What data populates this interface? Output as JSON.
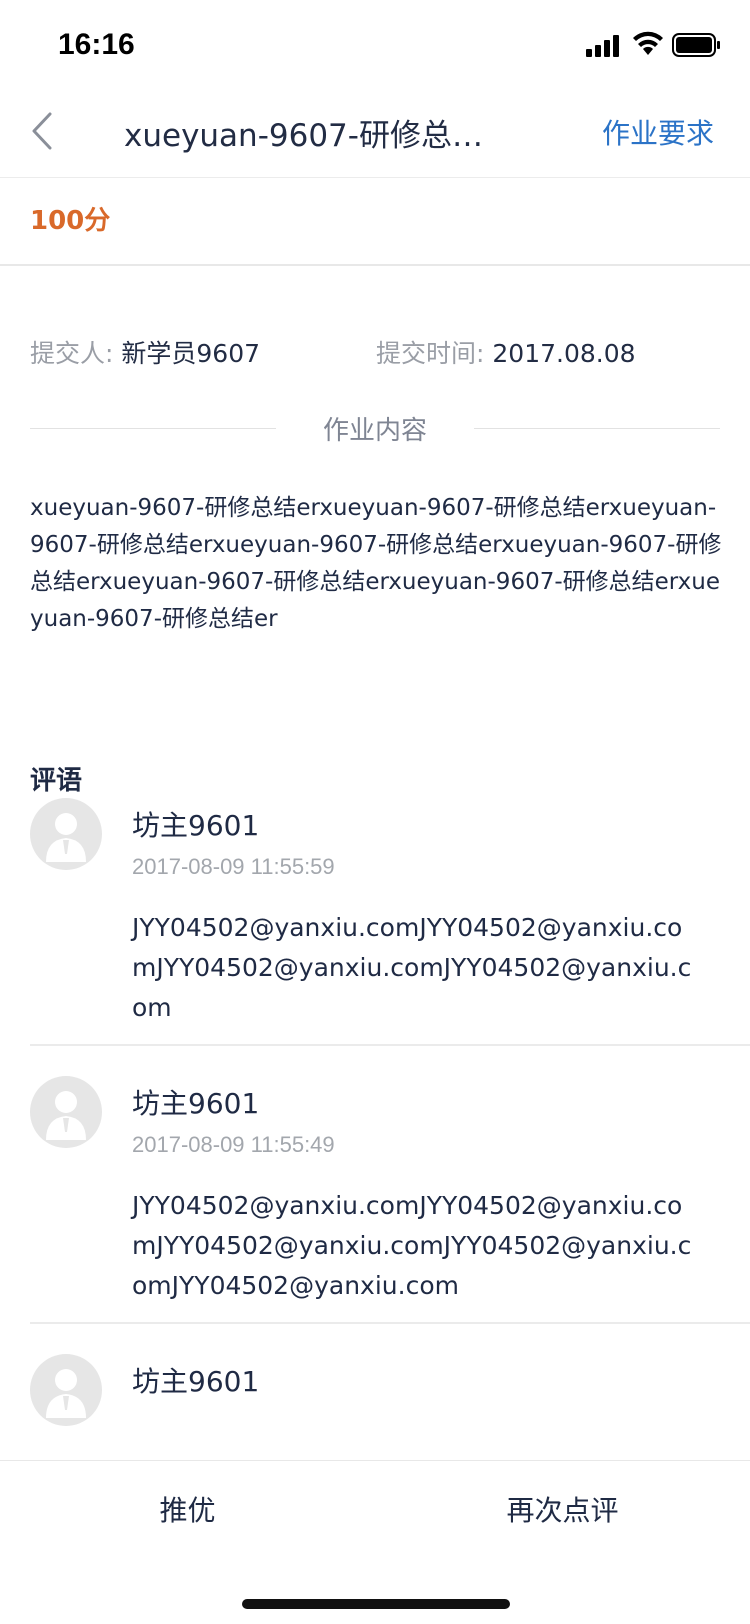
{
  "status_bar": {
    "time": "16:16"
  },
  "nav": {
    "title": "xueyuan-9607-研修总…",
    "action": "作业要求"
  },
  "score": "100分",
  "submit": {
    "submitter_label": "提交人:",
    "submitter_value": "新学员9607",
    "time_label": "提交时间:",
    "time_value": "2017.08.08"
  },
  "section_title": "作业内容",
  "content_text": "xueyuan-9607-研修总结erxueyuan-9607-研修总结erxueyuan-9607-研修总结erxueyuan-9607-研修总结erxueyuan-9607-研修总结erxueyuan-9607-研修总结erxueyuan-9607-研修总结erxueyuan-9607-研修总结er",
  "comments_title": "评语",
  "comments": [
    {
      "name": "坊主9601",
      "time": "2017-08-09 11:55:59",
      "text": "JYY04502@yanxiu.comJYY04502@yanxiu.comJYY04502@yanxiu.comJYY04502@yanxiu.com"
    },
    {
      "name": "坊主9601",
      "time": "2017-08-09 11:55:49",
      "text": "JYY04502@yanxiu.comJYY04502@yanxiu.comJYY04502@yanxiu.comJYY04502@yanxiu.comJYY04502@yanxiu.com"
    },
    {
      "name": "坊主9601"
    }
  ],
  "bottom": {
    "left_button": "推优",
    "right_button": "再次点评"
  }
}
